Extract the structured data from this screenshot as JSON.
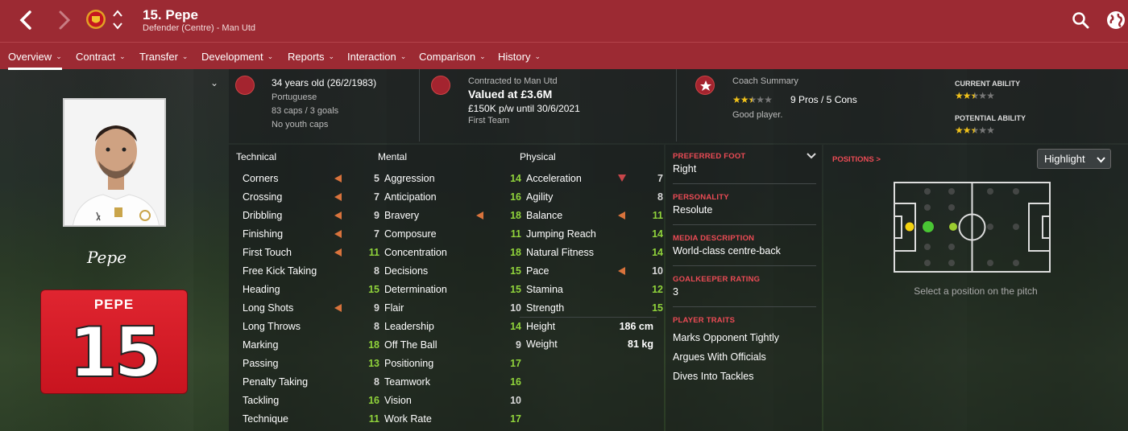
{
  "header": {
    "title": "15. Pepe",
    "subtitle": "Defender (Centre) - Man Utd"
  },
  "tabs": [
    {
      "label": "Overview",
      "active": true
    },
    {
      "label": "Contract"
    },
    {
      "label": "Transfer"
    },
    {
      "label": "Development"
    },
    {
      "label": "Reports"
    },
    {
      "label": "Interaction"
    },
    {
      "label": "Comparison"
    },
    {
      "label": "History"
    }
  ],
  "player_card": {
    "signature": "Pepe",
    "shirt_name": "PEPE",
    "shirt_number": "15"
  },
  "info": {
    "age": "34 years old (26/2/1983)",
    "nationality": "Portuguese",
    "caps": "83 caps / 3 goals",
    "youth": "No youth caps",
    "contracted": "Contracted to Man Utd",
    "value": "Valued at £3.6M",
    "wage": "£150K p/w until 30/6/2021",
    "squad": "First Team",
    "coach_label": "Coach Summary",
    "coach_stars": 2.5,
    "pros_cons": "9 Pros / 5 Cons",
    "coach_verdict": "Good player.",
    "current_ability_label": "CURRENT ABILITY",
    "current_ability_stars": 2.5,
    "potential_ability_label": "POTENTIAL ABILITY",
    "potential_ability_stars": 2.5
  },
  "attributes": {
    "technical_label": "Technical",
    "mental_label": "Mental",
    "physical_label": "Physical",
    "technical": [
      {
        "name": "Corners",
        "value": "5",
        "trend": "down"
      },
      {
        "name": "Crossing",
        "value": "7",
        "trend": "down"
      },
      {
        "name": "Dribbling",
        "value": "9",
        "trend": "down"
      },
      {
        "name": "Finishing",
        "value": "7",
        "trend": "down"
      },
      {
        "name": "First Touch",
        "value": "11",
        "trend": "down"
      },
      {
        "name": "Free Kick Taking",
        "value": "8"
      },
      {
        "name": "Heading",
        "value": "15"
      },
      {
        "name": "Long Shots",
        "value": "9",
        "trend": "down"
      },
      {
        "name": "Long Throws",
        "value": "8"
      },
      {
        "name": "Marking",
        "value": "18"
      },
      {
        "name": "Passing",
        "value": "13"
      },
      {
        "name": "Penalty Taking",
        "value": "8"
      },
      {
        "name": "Tackling",
        "value": "16"
      },
      {
        "name": "Technique",
        "value": "11"
      }
    ],
    "mental": [
      {
        "name": "Aggression",
        "value": "14"
      },
      {
        "name": "Anticipation",
        "value": "16"
      },
      {
        "name": "Bravery",
        "value": "18",
        "trend": "down"
      },
      {
        "name": "Composure",
        "value": "11"
      },
      {
        "name": "Concentration",
        "value": "18"
      },
      {
        "name": "Decisions",
        "value": "15"
      },
      {
        "name": "Determination",
        "value": "15"
      },
      {
        "name": "Flair",
        "value": "10"
      },
      {
        "name": "Leadership",
        "value": "14"
      },
      {
        "name": "Off The Ball",
        "value": "9"
      },
      {
        "name": "Positioning",
        "value": "17"
      },
      {
        "name": "Teamwork",
        "value": "16"
      },
      {
        "name": "Vision",
        "value": "10"
      },
      {
        "name": "Work Rate",
        "value": "17"
      }
    ],
    "physical": [
      {
        "name": "Acceleration",
        "value": "7",
        "trend": "strongdown"
      },
      {
        "name": "Agility",
        "value": "8"
      },
      {
        "name": "Balance",
        "value": "11",
        "trend": "down"
      },
      {
        "name": "Jumping Reach",
        "value": "14"
      },
      {
        "name": "Natural Fitness",
        "value": "14"
      },
      {
        "name": "Pace",
        "value": "10",
        "trend": "down"
      },
      {
        "name": "Stamina",
        "value": "12"
      },
      {
        "name": "Strength",
        "value": "15"
      }
    ],
    "height_label": "Height",
    "height_value": "186 cm",
    "weight_label": "Weight",
    "weight_value": "81 kg"
  },
  "side_info": {
    "preferred_foot_label": "PREFERRED FOOT",
    "preferred_foot": "Right",
    "personality_label": "PERSONALITY",
    "personality": "Resolute",
    "media_label": "MEDIA DESCRIPTION",
    "media": "World-class centre-back",
    "gk_label": "GOALKEEPER RATING",
    "gk": "3",
    "traits_label": "PLAYER TRAITS",
    "traits": [
      "Marks Opponent Tightly",
      "Argues With Officials",
      "Dives Into Tackles"
    ]
  },
  "positions": {
    "label": "POSITIONS >",
    "highlight_button": "Highlight",
    "caption": "Select a position on the pitch"
  },
  "colors": {
    "brand_red": "#9c2a33",
    "good_value": "#90d33b",
    "label_red": "#ec4b55",
    "trend_arrow": "#d9733c"
  }
}
